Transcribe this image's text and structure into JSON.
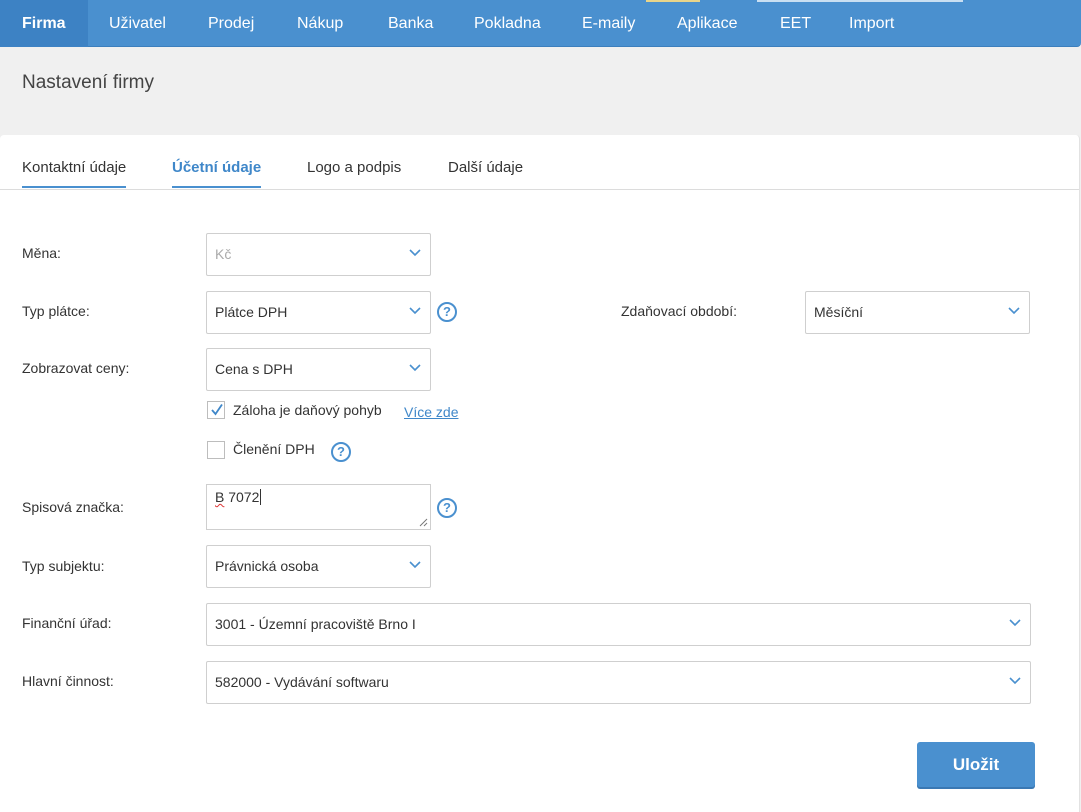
{
  "nav": {
    "items": [
      "Firma",
      "Uživatel",
      "Prodej",
      "Nákup",
      "Banka",
      "Pokladna",
      "E-maily",
      "Aplikace",
      "EET",
      "Import"
    ],
    "active": "Firma"
  },
  "page": {
    "title": "Nastavení firmy"
  },
  "tabs": [
    "Kontaktní údaje",
    "Účetní údaje",
    "Logo a podpis",
    "Další údaje"
  ],
  "form": {
    "mena": {
      "label": "Měna:",
      "value": "Kč"
    },
    "typ_platce": {
      "label": "Typ plátce:",
      "value": "Plátce DPH"
    },
    "zdanovaci_obdobi": {
      "label": "Zdaňovací období:",
      "value": "Měsíční"
    },
    "zobrazovat_ceny": {
      "label": "Zobrazovat ceny:",
      "value": "Cena s DPH"
    },
    "zaloha": {
      "label": "Záloha je daňový pohyb",
      "checked": true,
      "link": "Více zde"
    },
    "cleneni": {
      "label": "Členění DPH",
      "checked": false
    },
    "spisova_znacka": {
      "label": "Spisová značka:",
      "value_prefix": "B",
      "value_rest": " 7072"
    },
    "typ_subjektu": {
      "label": "Typ subjektu:",
      "value": "Právnická osoba"
    },
    "financni_urad": {
      "label": "Finanční úřad:",
      "value": "3001 - Územní pracoviště Brno I"
    },
    "hlavni_cinnost": {
      "label": "Hlavní činnost:",
      "value": "582000 - Vydávání softwaru"
    },
    "help_glyph": "?"
  },
  "actions": {
    "save": "Uložit"
  },
  "colors": {
    "accent": "#4a90cf",
    "nav_bg": "#4a90cf",
    "nav_active": "#3d82c4"
  }
}
